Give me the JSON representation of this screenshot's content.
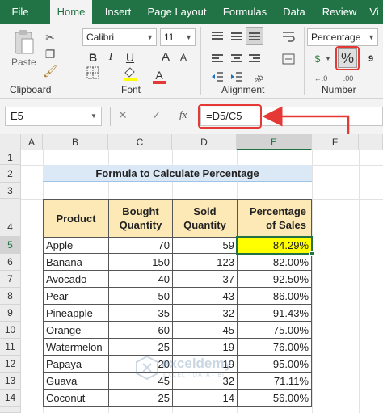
{
  "ribbon_tabs": [
    {
      "label": "File"
    },
    {
      "label": "Home"
    },
    {
      "label": "Insert"
    },
    {
      "label": "Page Layout"
    },
    {
      "label": "Formulas"
    },
    {
      "label": "Data"
    },
    {
      "label": "Review"
    },
    {
      "label": "Vi"
    }
  ],
  "ribbon": {
    "clipboard_label": "Clipboard",
    "paste_label": "Paste",
    "font_label": "Font",
    "font_name": "Calibri",
    "font_size": "11",
    "alignment_label": "Alignment",
    "number_label": "Number",
    "number_format": "Percentage",
    "bold": "B",
    "italic": "I",
    "underline": "U",
    "grow_font": "A",
    "shrink_font": "A",
    "font_color": "A",
    "percent_style": "%",
    "decimal_increase": "←.0",
    "decimal_decrease": ".00",
    "currency": "$",
    "comma": "9"
  },
  "formula_bar": {
    "name_box": "E5",
    "cancel": "✕",
    "enter": "✓",
    "fx": "fx",
    "formula": "=D5/C5"
  },
  "columns": [
    "A",
    "B",
    "C",
    "D",
    "E",
    "F"
  ],
  "rows": [
    "1",
    "2",
    "3",
    "4",
    "5",
    "6",
    "7",
    "8",
    "9",
    "10",
    "11",
    "12",
    "13",
    "14"
  ],
  "sheet": {
    "title": "Formula to Calculate Percentage",
    "headers": {
      "product": "Product",
      "bought_1": "Bought",
      "bought_2": "Quantity",
      "sold_1": "Sold",
      "sold_2": "Quantity",
      "pct_1": "Percentage",
      "pct_2": "of Sales"
    },
    "data": [
      [
        "Apple",
        "70",
        "59",
        "84.29%"
      ],
      [
        "Banana",
        "150",
        "123",
        "82.00%"
      ],
      [
        "Avocado",
        "40",
        "37",
        "92.50%"
      ],
      [
        "Pear",
        "50",
        "43",
        "86.00%"
      ],
      [
        "Pineapple",
        "35",
        "32",
        "91.43%"
      ],
      [
        "Orange",
        "60",
        "45",
        "75.00%"
      ],
      [
        "Watermelon",
        "25",
        "19",
        "76.00%"
      ],
      [
        "Papaya",
        "20",
        "19",
        "95.00%"
      ],
      [
        "Guava",
        "45",
        "32",
        "71.11%"
      ],
      [
        "Coconut",
        "25",
        "14",
        "56.00%"
      ]
    ]
  },
  "watermark": {
    "name": "exceldemy",
    "tagline": "EXCEL · DATA · BI"
  },
  "colors": {
    "excel_green": "#217346",
    "highlight": "#ffff00",
    "annotation_red": "#e53935",
    "header_fill": "#fde9b6",
    "title_fill": "#dbe9f7"
  }
}
